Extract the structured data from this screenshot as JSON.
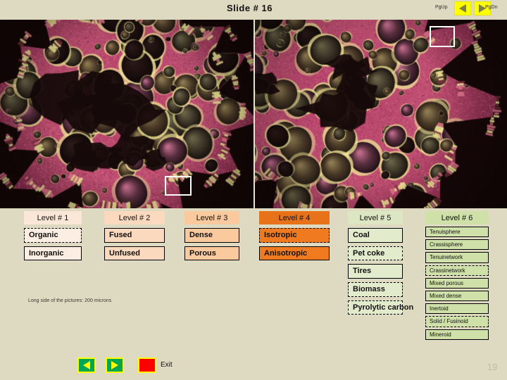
{
  "header": {
    "slide_title": "Slide  # 16",
    "pgup_label": "PgUp",
    "pgdn_label": "PgDn"
  },
  "images": {
    "caption": "Long side of the pictures: 200 microns",
    "left_alt": "coal-petrography-micrograph-left",
    "right_alt": "coal-petrography-micrograph-right"
  },
  "levels": [
    {
      "header": "Level # 1",
      "head_color": "#fbe7d8",
      "item_color": "#fdeee3",
      "items": [
        {
          "label": "Organic",
          "selected": true
        },
        {
          "label": "Inorganic",
          "selected": false
        }
      ]
    },
    {
      "header": "Level # 2",
      "head_color": "#fbd9bf",
      "item_color": "#fbd9bf",
      "items": [
        {
          "label": "Fused",
          "selected": false
        },
        {
          "label": "Unfused",
          "selected": false
        }
      ]
    },
    {
      "header": "Level # 3",
      "head_color": "#fbc99e",
      "item_color": "#fbc99e",
      "items": [
        {
          "label": "Dense",
          "selected": false
        },
        {
          "label": "Porous",
          "selected": false
        }
      ]
    },
    {
      "header": "Level # 4",
      "head_color": "#e8721a",
      "item_color": "#ef7a1f",
      "items": [
        {
          "label": "Isotropic",
          "selected": true
        },
        {
          "label": "Anisotropic",
          "selected": false
        }
      ]
    },
    {
      "header": "Level # 5",
      "head_color": "#dce6c3",
      "item_color": "#e3ebcd",
      "items": [
        {
          "label": "Coal",
          "selected": false
        },
        {
          "label": "Pet coke",
          "selected": true
        },
        {
          "label": "Tires",
          "selected": false
        },
        {
          "label": "Biomass",
          "selected": true
        },
        {
          "label": "Pyrolytic carbon",
          "selected": true
        }
      ]
    },
    {
      "header": "Level # 6",
      "head_color": "#cfe0a8",
      "item_color": "#cfe0a8",
      "items": [
        {
          "label": "Tenuisphere",
          "selected": false
        },
        {
          "label": "Crassisphere",
          "selected": false
        },
        {
          "label": "Tenuinetwork",
          "selected": false
        },
        {
          "label": "Crassinetwork",
          "selected": true
        },
        {
          "label": "Mixed porous",
          "selected": false
        },
        {
          "label": "Mixed dense",
          "selected": false
        },
        {
          "label": "Inertoid",
          "selected": false
        },
        {
          "label": "Solid / Fusinoid",
          "selected": true
        },
        {
          "label": "Mineroid",
          "selected": false
        }
      ]
    }
  ],
  "footer": {
    "exit_label": "Exit",
    "page_number": "19"
  },
  "colors": {
    "background": "#dedac2",
    "accent_yellow": "#ffff00",
    "accent_green": "#00a651",
    "accent_red": "#ff0000",
    "level4_orange": "#e8721a"
  }
}
